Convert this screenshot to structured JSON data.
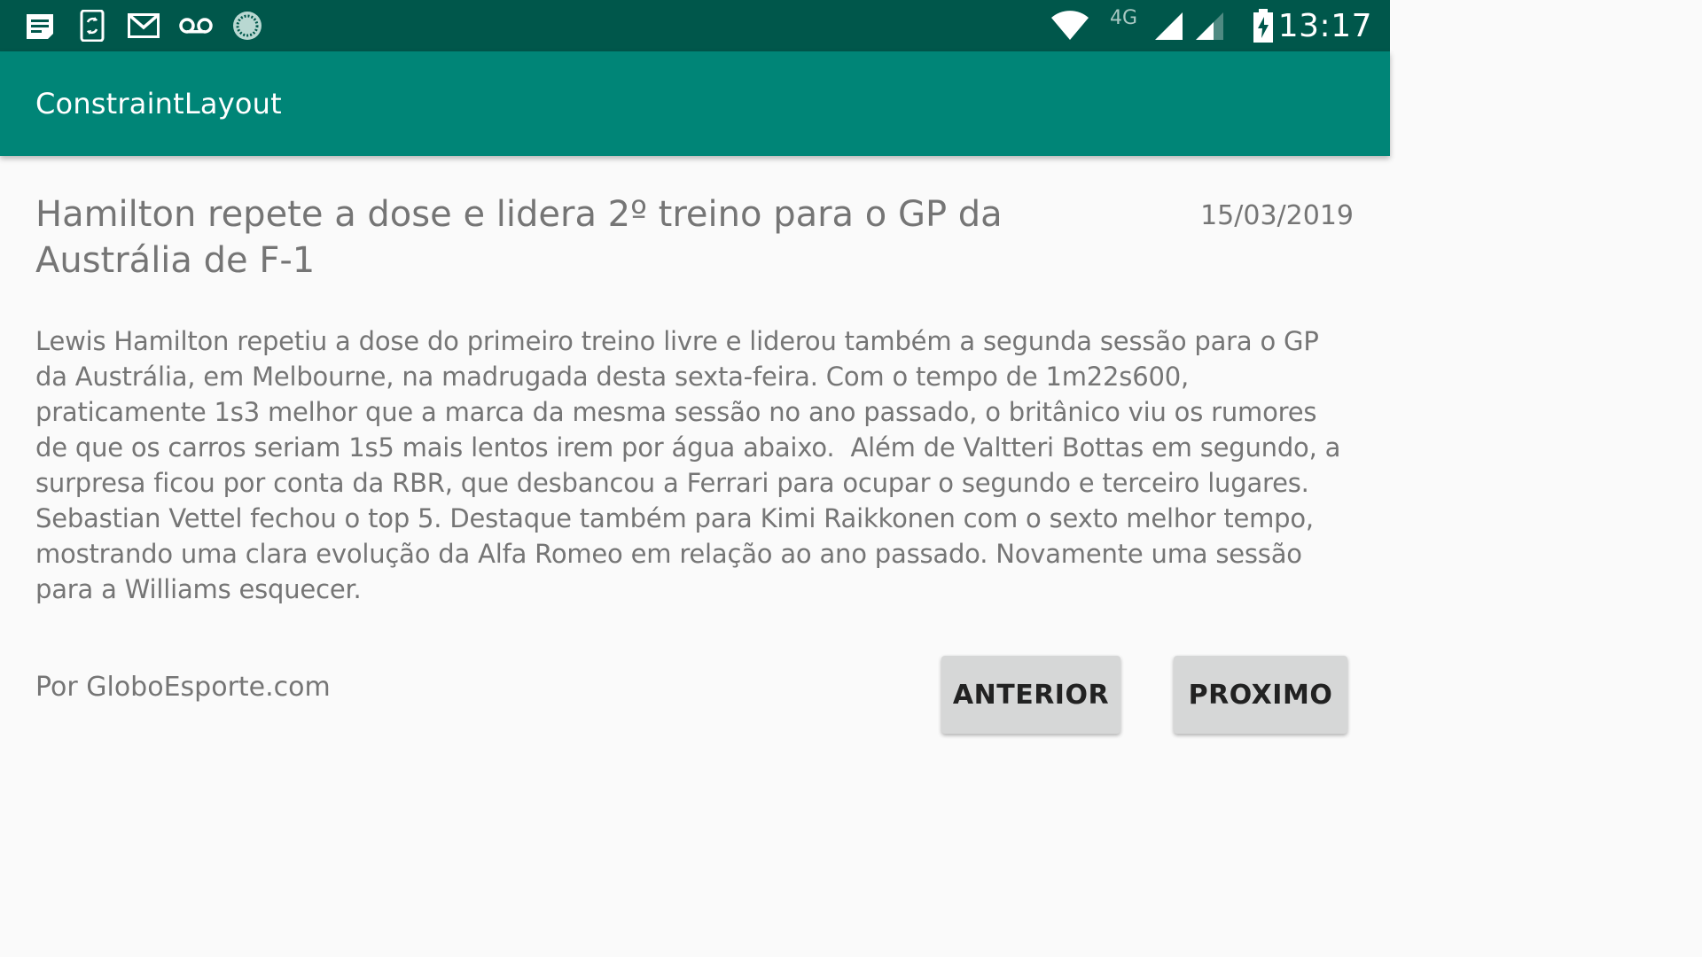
{
  "status_bar": {
    "time": "13:17",
    "network": "4G",
    "background_color": "#00574b",
    "left_icons": [
      "notes-icon",
      "phone-sync-icon",
      "gmail-icon",
      "voicemail-icon",
      "loading-circle-icon"
    ],
    "right_icons": [
      "wifi-icon",
      "signal-icon",
      "signal-icon-secondary",
      "battery-charging-icon"
    ]
  },
  "app_bar": {
    "title": "ConstraintLayout",
    "background_color": "#008577"
  },
  "article": {
    "title": "Hamilton repete a dose e lidera 2º treino para o GP da Austrália de F-1",
    "date": "15/03/2019",
    "body": "Lewis Hamilton repetiu a dose do primeiro treino livre e liderou também a segunda sessão para o GP da Austrália, em Melbourne, na madrugada desta sexta-feira. Com o tempo de 1m22s600, praticamente 1s3 melhor que a marca da mesma sessão no ano passado, o britânico viu os rumores de que os carros seriam 1s5 mais lentos irem por água abaixo.  Além de Valtteri Bottas em segundo, a surpresa ficou por conta da RBR, que desbancou a Ferrari para ocupar o segundo e terceiro lugares. Sebastian Vettel fechou o top 5. Destaque também para Kimi Raikkonen com o sexto melhor tempo, mostrando uma clara evolução da Alfa Romeo em relação ao ano passado. Novamente uma sessão para a Williams esquecer.",
    "source": "Por GloboEsporte.com"
  },
  "buttons": {
    "previous_label": "ANTERIOR",
    "next_label": "PROXIMO"
  }
}
